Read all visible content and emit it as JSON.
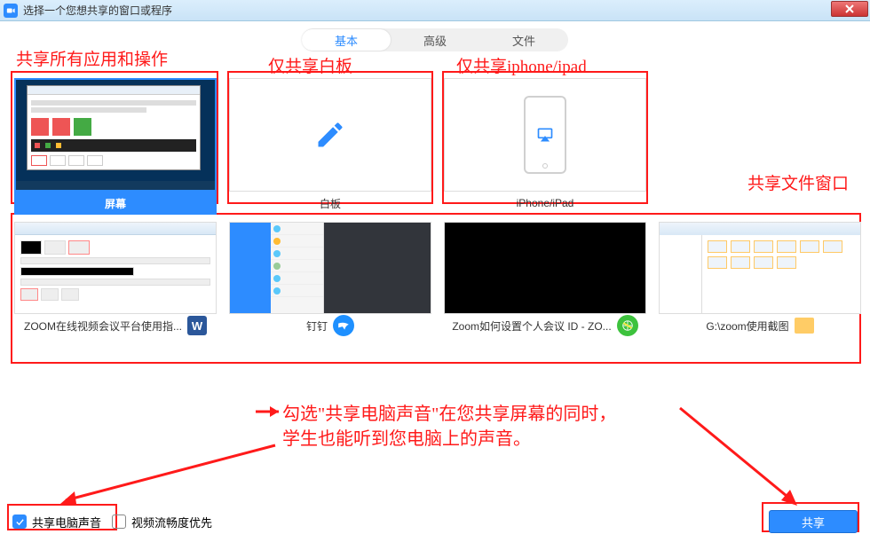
{
  "titlebar": {
    "text": "选择一个您想共享的窗口或程序"
  },
  "tabs": {
    "basic": "基本",
    "advanced": "高级",
    "file": "文件"
  },
  "annotations": {
    "allApps": "共享所有应用和操作",
    "whiteboardOnly": "仅共享白板",
    "iphoneOnly": "仅共享iphone/ipad",
    "fileWindow": "共享文件窗口",
    "audioHint1": "勾选\"共享电脑声音\"在您共享屏幕的同时，",
    "audioHint2": "学生也能听到您电脑上的声音。"
  },
  "cards": {
    "screen": "屏幕",
    "whiteboard": "白板",
    "iphone": "iPhone/iPad",
    "doc": "ZOOM在线视频会议平台使用指...",
    "dingding": "钉钉",
    "zoomSettings": "Zoom如何设置个人会议 ID - ZO...",
    "folder": "G:\\zoom使用截图"
  },
  "bottom": {
    "shareAudio": "共享电脑声音",
    "fluency": "视频流畅度优先",
    "shareBtn": "共享"
  }
}
